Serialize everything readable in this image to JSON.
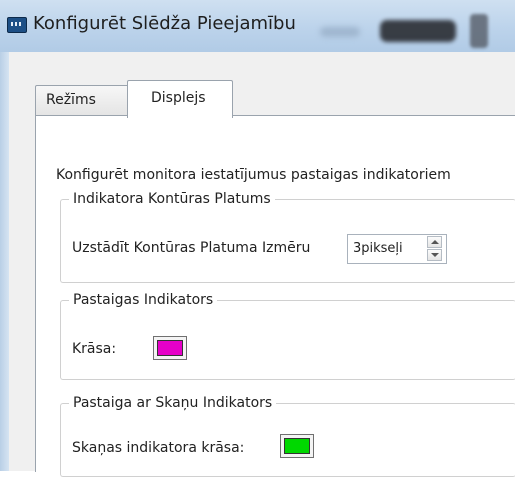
{
  "window": {
    "title": "Konfigurēt Slēdža Pieejamību"
  },
  "tabs": [
    {
      "label": "Režīms",
      "selected": false
    },
    {
      "label": "Displejs",
      "selected": true
    }
  ],
  "panel": {
    "description": "Konfigurēt monitora iestatījumus pastaigas indikatoriem",
    "outline_group": {
      "title": "Indikatora Kontūras Platums",
      "size_label": "Uzstādīt Kontūras Platuma Izmēru",
      "size_value": "3pikseļi"
    },
    "walk_group": {
      "title": "Pastaigas Indikators",
      "color_label": "Krāsa:",
      "color": "#e600c8"
    },
    "sound_group": {
      "title": "Pastaiga ar Skaņu Indikators",
      "color_label": "Skaņas indikatora krāsa:",
      "color": "#00d800"
    }
  },
  "icons": {
    "app": "app-icon",
    "spin_up": "arrow-up-icon",
    "spin_down": "arrow-down-icon"
  }
}
